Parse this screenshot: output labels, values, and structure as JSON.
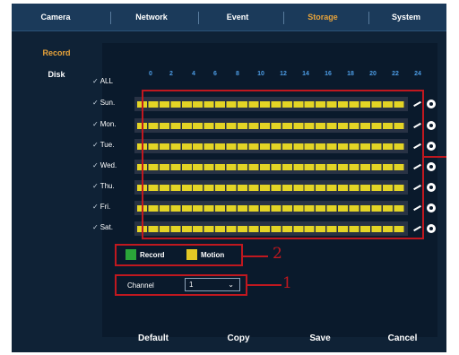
{
  "nav": {
    "tabs": [
      {
        "label": "Camera"
      },
      {
        "label": "Network"
      },
      {
        "label": "Event"
      },
      {
        "label": "Storage"
      },
      {
        "label": "System"
      }
    ],
    "active_tab": "Storage"
  },
  "sidebar": {
    "items": [
      {
        "label": "Record"
      },
      {
        "label": "Disk"
      }
    ],
    "active": "Record"
  },
  "schedule": {
    "all_label": "ALL",
    "hours": [
      "0",
      "2",
      "4",
      "6",
      "8",
      "10",
      "12",
      "14",
      "16",
      "18",
      "20",
      "22",
      "24"
    ],
    "days": [
      {
        "label": "Sun."
      },
      {
        "label": "Mon."
      },
      {
        "label": "Tue."
      },
      {
        "label": "Wed."
      },
      {
        "label": "Thu."
      },
      {
        "label": "Fri."
      },
      {
        "label": "Sat."
      }
    ],
    "fill_color": "#e3d425"
  },
  "legend": {
    "record": {
      "label": "Record",
      "color": "#2aa639"
    },
    "motion": {
      "label": "Motion",
      "color": "#e3c825"
    }
  },
  "channel": {
    "label": "Channel",
    "value": "1"
  },
  "annotations": {
    "one": "1",
    "two": "2"
  },
  "buttons": {
    "default": "Default",
    "copy": "Copy",
    "save": "Save",
    "cancel": "Cancel"
  },
  "colors": {
    "active_accent": "#e8a33a",
    "annotation_red": "#c0181f",
    "hour_blue": "#4c9be3"
  }
}
